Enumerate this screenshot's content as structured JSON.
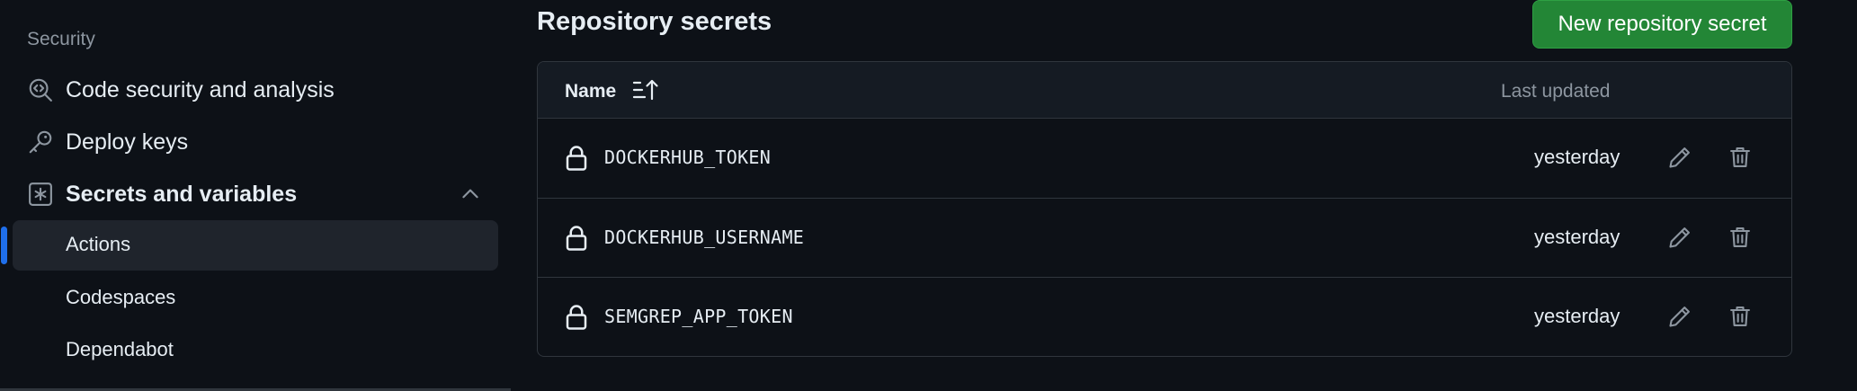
{
  "sidebar": {
    "section_heading": "Security",
    "items": [
      {
        "label": "Code security and analysis",
        "icon": "codescan-icon"
      },
      {
        "label": "Deploy keys",
        "icon": "key-icon"
      },
      {
        "label": "Secrets and variables",
        "icon": "asterisk-square-icon",
        "expanded": true
      }
    ],
    "sub_items": [
      {
        "label": "Actions",
        "active": true
      },
      {
        "label": "Codespaces",
        "active": false
      },
      {
        "label": "Dependabot",
        "active": false
      }
    ]
  },
  "main": {
    "title": "Repository secrets",
    "new_button_label": "New repository secret",
    "table": {
      "columns": [
        "Name",
        "Last updated"
      ],
      "sort_icon": "sort-asc-icon",
      "rows": [
        {
          "name": "DOCKERHUB_TOKEN",
          "updated": "yesterday"
        },
        {
          "name": "DOCKERHUB_USERNAME",
          "updated": "yesterday"
        },
        {
          "name": "SEMGREP_APP_TOKEN",
          "updated": "yesterday"
        }
      ]
    }
  },
  "colors": {
    "background": "#0d1117",
    "accent": "#1f6feb",
    "button_green": "#238636",
    "border": "#30363d",
    "muted_text": "#8d96a0"
  }
}
